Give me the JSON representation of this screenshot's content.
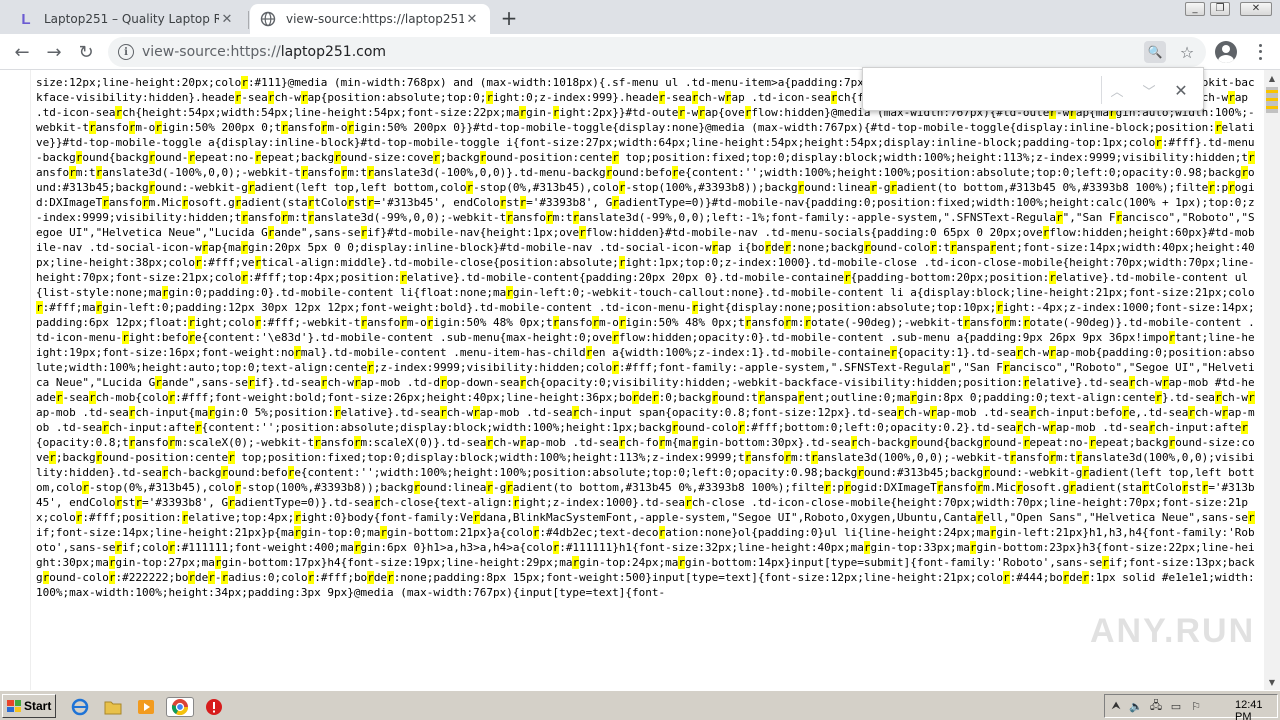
{
  "tabs": [
    {
      "title": "Laptop251 – Quality Laptop Reviews",
      "active": false
    },
    {
      "title": "view-source:https://laptop251.com",
      "active": true
    }
  ],
  "address": {
    "prefix": "view-source:https://",
    "host": "laptop251.com"
  },
  "findbar": {
    "query": "",
    "count": ""
  },
  "source_code": "size:12px;line-height:20px;color:#111}@media (min-width:768px) and (max-width:1018px){.sf-menu ul .td-menu-item>a{padding:7px 12px}}.header-search-wrap .td-drop-down-search{-webkit-backface-visibility:hidden}.header-search-wrap{position:absolute;top:0;right:0;z-index:999}.header-search-wrap .td-icon-search{font-size:15px}@media (max-width:767px){.header-search-wrap .td-icon-search{height:54px;width:54px;line-height:54px;font-size:22px;margin-right:2px}}#td-outer-wrap{overflow:hidden}@media (max-width:767px){#td-outer-wrap{margin:auto;width:100%;-webkit-transform-origin:50% 200px 0;transform-origin:50% 200px 0}}#td-top-mobile-toggle{display:none}@media (max-width:767px){#td-top-mobile-toggle{display:inline-block;position:relative}}#td-top-mobile-toggle a{display:inline-block}#td-top-mobile-toggle i{font-size:27px;width:64px;line-height:54px;height:54px;display:inline-block;padding-top:1px;color:#fff}.td-menu-background{background-repeat:no-repeat;background-size:cover;background-position:center top;position:fixed;top:0;display:block;width:100%;height:113%;z-index:9999;visibility:hidden;transform:translate3d(-100%,0,0);-webkit-transform:translate3d(-100%,0,0)}.td-menu-background:before{content:'';width:100%;height:100%;position:absolute;top:0;left:0;opacity:0.98;background:#313b45;background:-webkit-gradient(left top,left bottom,color-stop(0%,#313b45),color-stop(100%,#3393b8));background:linear-gradient(to bottom,#313b45 0%,#3393b8 100%);filter:progid:DXImageTransform.Microsoft.gradient(startColorstr='#313b45', endColorstr='#3393b8', GradientType=0)}#td-mobile-nav{padding:0;position:fixed;width:100%;height:calc(100% + 1px);top:0;z-index:9999;visibility:hidden;transform:translate3d(-99%,0,0);-webkit-transform:translate3d(-99%,0,0);left:-1%;font-family:-apple-system,\".SFNSText-Regular\",\"San Francisco\",\"Roboto\",\"Segoe UI\",\"Helvetica Neue\",\"Lucida Grande\",sans-serif}#td-mobile-nav{height:1px;overflow:hidden}#td-mobile-nav .td-menu-socials{padding:0 65px 0 20px;overflow:hidden;height:60px}#td-mobile-nav .td-social-icon-wrap{margin:20px 5px 0 0;display:inline-block}#td-mobile-nav .td-social-icon-wrap i{border:none;background-color:transparent;font-size:14px;width:40px;height:40px;line-height:38px;color:#fff;vertical-align:middle}.td-mobile-close{position:absolute;right:1px;top:0;z-index:1000}.td-mobile-close .td-icon-close-mobile{height:70px;width:70px;line-height:70px;font-size:21px;color:#fff;top:4px;position:relative}.td-mobile-content{padding:20px 20px 0}.td-mobile-container{padding-bottom:20px;position:relative}.td-mobile-content ul{list-style:none;margin:0;padding:0}.td-mobile-content li{float:none;margin-left:0;-webkit-touch-callout:none}.td-mobile-content li a{display:block;line-height:21px;font-size:21px;color:#fff;margin-left:0;padding:12px 30px 12px 12px;font-weight:bold}.td-mobile-content .td-icon-menu-right{display:none;position:absolute;top:10px;right:-4px;z-index:1000;font-size:14px;padding:6px 12px;float:right;color:#fff;-webkit-transform-origin:50% 48% 0px;transform-origin:50% 48% 0px;transform:rotate(-90deg);-webkit-transform:rotate(-90deg)}.td-mobile-content .td-icon-menu-right:before{content:'\\e83d'}.td-mobile-content .sub-menu{max-height:0;overflow:hidden;opacity:0}.td-mobile-content .sub-menu a{padding:9px 26px 9px 36px!important;line-height:19px;font-size:16px;font-weight:normal}.td-mobile-content .menu-item-has-children a{width:100%;z-index:1}.td-mobile-container{opacity:1}.td-search-wrap-mob{padding:0;position:absolute;width:100%;height:auto;top:0;text-align:center;z-index:9999;visibility:hidden;color:#fff;font-family:-apple-system,\".SFNSText-Regular\",\"San Francisco\",\"Roboto\",\"Segoe UI\",\"Helvetica Neue\",\"Lucida Grande\",sans-serif}.td-search-wrap-mob .td-drop-down-search{opacity:0;visibility:hidden;-webkit-backface-visibility:hidden;position:relative}.td-search-wrap-mob #td-header-search-mob{color:#fff;font-weight:bold;font-size:26px;height:40px;line-height:36px;border:0;background:transparent;outline:0;margin:8px 0;padding:0;text-align:center}.td-search-wrap-mob .td-search-input{margin:0 5%;position:relative}.td-search-wrap-mob .td-search-input span{opacity:0.8;font-size:12px}.td-search-wrap-mob .td-search-input:before,.td-search-wrap-mob .td-search-input:after{content:'';position:absolute;display:block;width:100%;height:1px;background-color:#fff;bottom:0;left:0;opacity:0.2}.td-search-wrap-mob .td-search-input:after{opacity:0.8;transform:scaleX(0);-webkit-transform:scaleX(0)}.td-search-wrap-mob .td-search-form{margin-bottom:30px}.td-search-background{background-repeat:no-repeat;background-size:cover;background-position:center top;position:fixed;top:0;display:block;width:100%;height:113%;z-index:9999;transform:translate3d(100%,0,0);-webkit-transform:translate3d(100%,0,0);visibility:hidden}.td-search-background:before{content:'';width:100%;height:100%;position:absolute;top:0;left:0;opacity:0.98;background:#313b45;background:-webkit-gradient(left top,left bottom,color-stop(0%,#313b45),color-stop(100%,#3393b8));background:linear-gradient(to bottom,#313b45 0%,#3393b8 100%);filter:progid:DXImageTransform.Microsoft.gradient(startColorstr='#313b45', endColorstr='#3393b8', GradientType=0)}.td-search-close{text-align:right;z-index:1000}.td-search-close .td-icon-close-mobile{height:70px;width:70px;line-height:70px;font-size:21px;color:#fff;position:relative;top:4px;right:0}body{font-family:Verdana,BlinkMacSystemFont,-apple-system,\"Segoe UI\",Roboto,Oxygen,Ubuntu,Cantarell,\"Open Sans\",\"Helvetica Neue\",sans-serif;font-size:14px;line-height:21px}p{margin-top:0;margin-bottom:21px}a{color:#4db2ec;text-decoration:none}ol{padding:0}ul li{line-height:24px;margin-left:21px}h1,h3,h4{font-family:'Roboto',sans-serif;color:#111111;font-weight:400;margin:6px 0}h1>a,h3>a,h4>a{color:#111111}h1{font-size:32px;line-height:40px;margin-top:33px;margin-bottom:23px}h3{font-size:22px;line-height:30px;margin-top:27px;margin-bottom:17px}h4{font-size:19px;line-height:29px;margin-top:24px;margin-bottom:14px}input[type=submit]{font-family:'Roboto',sans-serif;font-size:13px;background-color:#222222;border-radius:0;color:#fff;border:none;padding:8px 15px;font-weight:500}input[type=text]{font-size:12px;line-height:21px;color:#444;border:1px solid #e1e1e1;width:100%;max-width:100%;height:34px;padding:3px 9px}@media (max-width:767px){input[type=text]{font-",
  "highlight_chars": "r",
  "taskbar": {
    "start_label": "Start",
    "clock": "12:41 PM"
  },
  "watermark": "ANY.RUN"
}
